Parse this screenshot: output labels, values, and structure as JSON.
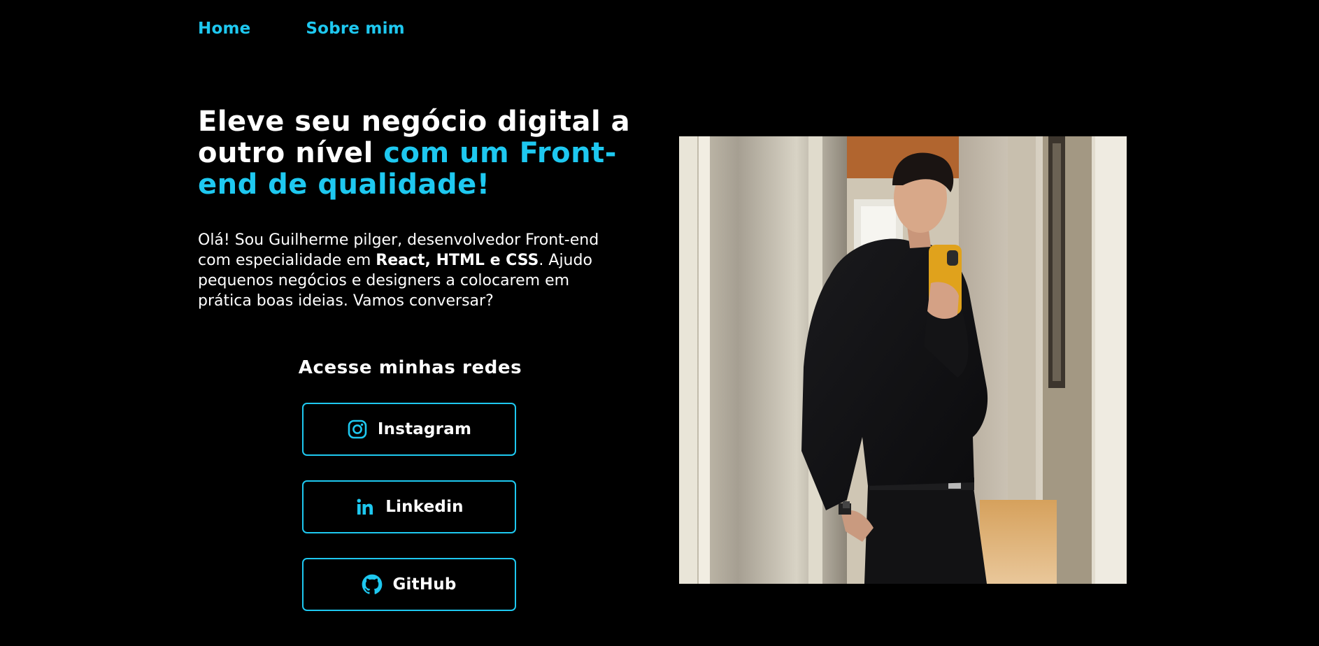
{
  "nav": {
    "items": [
      {
        "label": "Home"
      },
      {
        "label": "Sobre mim"
      }
    ]
  },
  "hero": {
    "title_white": "Eleve seu negócio digital a outro nível ",
    "title_accent": "com um Front-end de qualidade!",
    "intro_part1": "Olá! Sou Guilherme pilger, desenvolvedor Front-end com especialidade em ",
    "intro_bold": "React, HTML e CSS",
    "intro_part2": ". Ajudo pequenos negócios e designers a colocarem em prática boas ideias. Vamos conversar?"
  },
  "social": {
    "title": "Acesse minhas redes",
    "buttons": [
      {
        "label": "Instagram",
        "icon": "instagram-icon"
      },
      {
        "label": "Linkedin",
        "icon": "linkedin-icon"
      },
      {
        "label": "GitHub",
        "icon": "github-icon"
      }
    ]
  },
  "photo": {
    "description": "profile-photo"
  },
  "colors": {
    "background": "#000000",
    "accent": "#1ec8f0",
    "text": "#ffffff"
  }
}
